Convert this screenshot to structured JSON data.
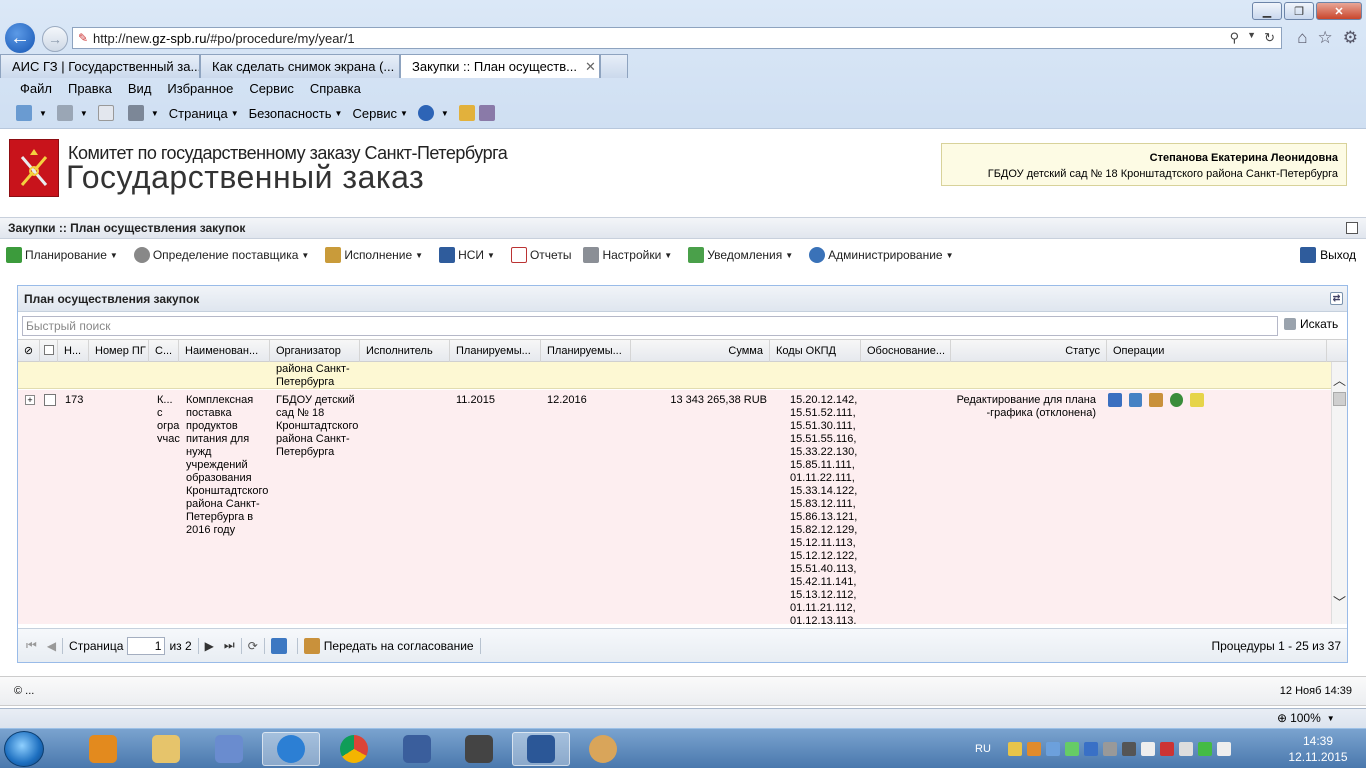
{
  "browser": {
    "url_prefix": "http://new.",
    "url_domain": "gz-spb.ru",
    "url_path": "/#po/procedure/my/year/1",
    "tabs": [
      {
        "label": "АИС ГЗ | Государственный за..."
      },
      {
        "label": "Как сделать снимок экрана (..."
      },
      {
        "label": "Закупки :: План осуществ..."
      }
    ],
    "menu": [
      "Файл",
      "Правка",
      "Вид",
      "Избранное",
      "Сервис",
      "Справка"
    ],
    "commands": {
      "page": "Страница",
      "security": "Безопасность",
      "service": "Сервис"
    }
  },
  "header": {
    "committee": "Комитет по государственному заказу Санкт-Петербурга",
    "title": "Государственный заказ",
    "user_name": "Степанова Екатерина Леонидовна",
    "user_org": "ГБДОУ детский сад № 18 Кронштадтского района Санкт-Петербурга"
  },
  "breadcrumb": "Закупки :: План осуществления закупок",
  "nav": {
    "items": [
      "Планирование",
      "Определение поставщика",
      "Исполнение",
      "НСИ",
      "Отчеты",
      "Настройки",
      "Уведомления",
      "Администрирование"
    ],
    "logout": "Выход"
  },
  "panel": {
    "title": "План осуществления закупок",
    "search_placeholder": "Быстрый поиск",
    "search_button": "Искать"
  },
  "table": {
    "columns": [
      "Н...",
      "Номер ПГ",
      "С...",
      "Наименован...",
      "Организатор",
      "Исполнитель",
      "Планируемы...",
      "Планируемы...",
      "Сумма",
      "Коды ОКПД",
      "Обоснование...",
      "Статус",
      "Операции"
    ],
    "row0": {
      "organizer": "района Санкт-\nПетербурга"
    },
    "row1": {
      "num": "173",
      "method": "К...\nс\nогра\nучас",
      "name": "Комплексная\nпоставка\nпродуктов\nпитания для\nнужд\nучреждений\nобразования\nКронштадтского\nрайона Санкт-\nПетербурга в\n2016 году",
      "organizer": "ГБДОУ детский\nсад № 18\nКронштадтского\nрайона Санкт-\nПетербурга",
      "plan1": "11.2015",
      "plan2": "12.2016",
      "sum": "13 343 265,38 RUB",
      "okpd": "15.20.12.142,\n15.51.52.111,\n15.51.30.111,\n15.51.55.116,\n15.33.22.130,\n15.85.11.111,\n01.11.22.111,\n15.33.14.122,\n15.83.12.111,\n15.86.13.121,\n15.82.12.129,\n15.12.11.113,\n15.12.12.122,\n15.51.40.113,\n15.42.11.141,\n15.13.12.112,\n01.11.21.112,\n01.12.13.113,",
      "status": "Редактирование для плана\n-графика (отклонена)"
    }
  },
  "pager": {
    "page_label": "Страница",
    "page_value": "1",
    "of_label": "из 2",
    "send_label": "Передать на согласование",
    "info": "Процедуры 1 - 25 из 37"
  },
  "footer": {
    "copyright": "© ...",
    "date": "12 Нояб 14:39"
  },
  "statusbar": {
    "zoom": "100%"
  },
  "taskbar": {
    "lang": "RU",
    "time": "14:39",
    "date": "12.11.2015"
  }
}
